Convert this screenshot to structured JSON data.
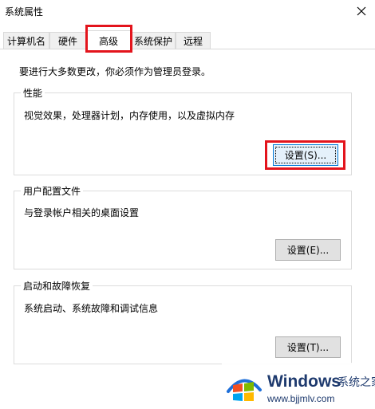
{
  "window": {
    "title": "系统属性",
    "close_icon": "close-icon"
  },
  "tabs": [
    {
      "label": "计算机名",
      "active": false
    },
    {
      "label": "硬件",
      "active": false
    },
    {
      "label": "高级",
      "active": true
    },
    {
      "label": "系统保护",
      "active": false
    },
    {
      "label": "远程",
      "active": false
    }
  ],
  "advanced": {
    "admin_note": "要进行大多数更改，你必须作为管理员登录。",
    "performance": {
      "label": "性能",
      "description": "视觉效果，处理器计划，内存使用，以及虚拟内存",
      "button": "设置(S)..."
    },
    "user_profiles": {
      "label": "用户配置文件",
      "description": "与登录帐户相关的桌面设置",
      "button": "设置(E)..."
    },
    "startup_recovery": {
      "label": "启动和故障恢复",
      "description": "系统启动、系统故障和调试信息",
      "button": "设置(T)..."
    }
  },
  "watermark": {
    "brand": "Windows",
    "brand_cn": "系统之家",
    "url": "www.bjjmlv.com"
  },
  "colors": {
    "highlight": "#e3141c",
    "brand": "#1e3a6e",
    "focus": "#0078d7"
  }
}
